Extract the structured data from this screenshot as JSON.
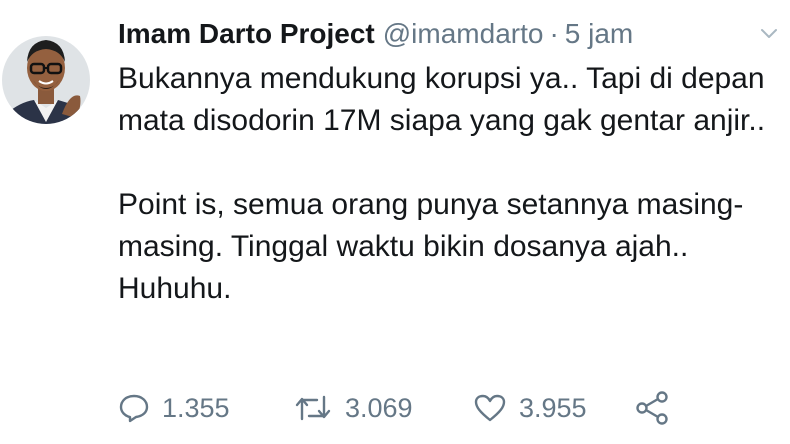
{
  "tweet": {
    "author_name": "Imam Darto Project",
    "handle": "@imamdarto",
    "separator": "·",
    "time": "5 jam",
    "paragraphs": [
      "Bukannya mendukung korupsi ya.. Tapi di depan mata disodorin 17M siapa yang gak gentar anjir..",
      "Point is, semua orang punya setannya masing-masing. Tinggal waktu bikin dosanya ajah.. Huhuhu."
    ]
  },
  "actions": {
    "replies": "1.355",
    "retweets": "3.069",
    "likes": "3.955"
  },
  "icons": {
    "avatar": "avatar-photo",
    "caret": "chevron-down-icon",
    "reply": "reply-icon",
    "retweet": "retweet-icon",
    "like": "heart-icon",
    "share": "share-icon"
  },
  "colors": {
    "text": "#14171a",
    "secondary": "#657786"
  }
}
